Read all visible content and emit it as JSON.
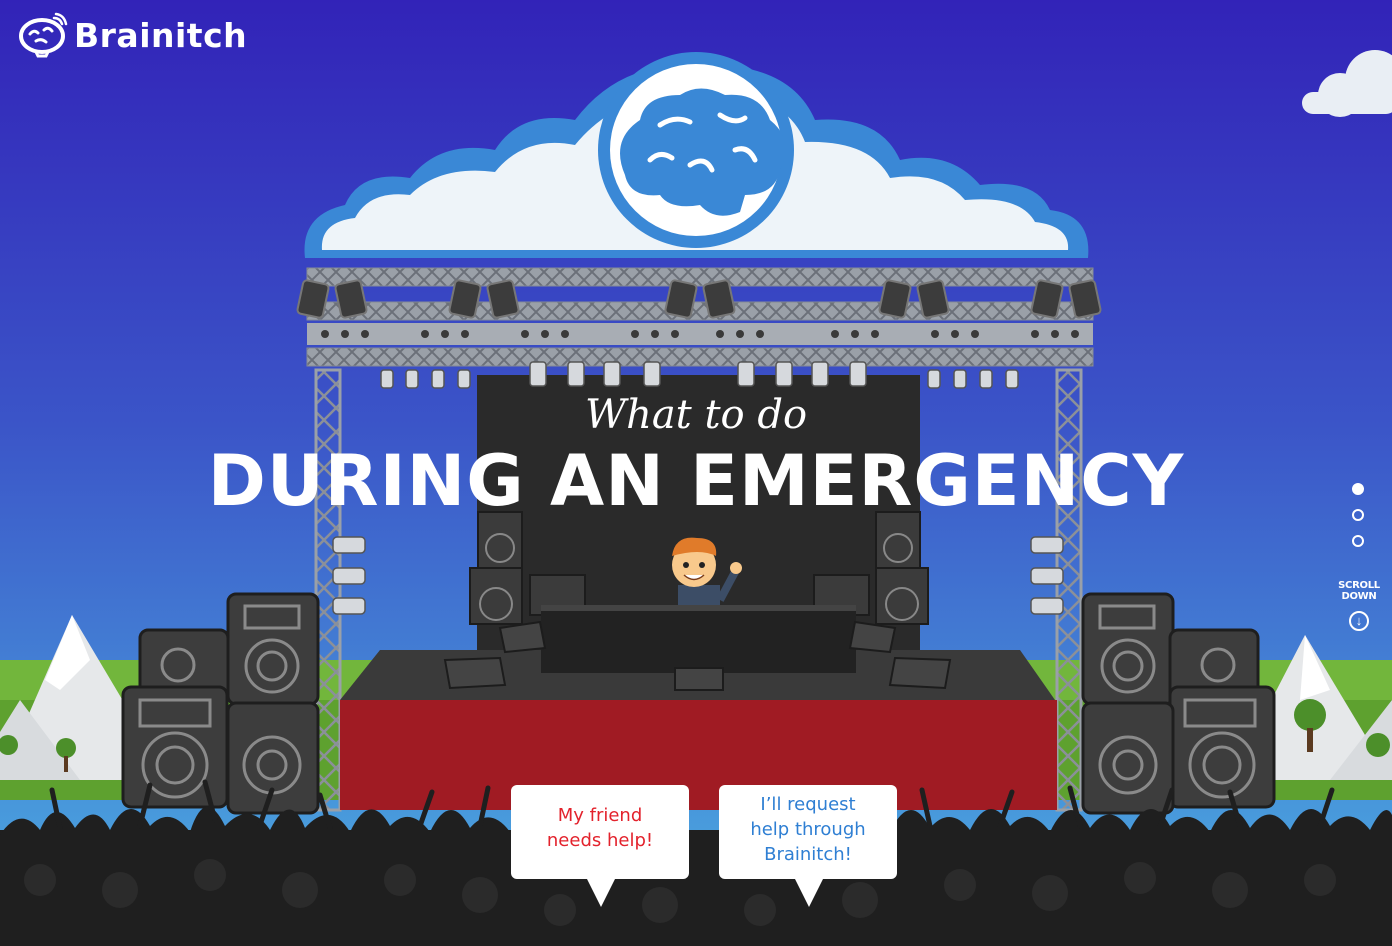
{
  "brand": {
    "name": "Brainitch"
  },
  "hero": {
    "subtitle": "What to do",
    "title": "DURING AN EMERGENCY"
  },
  "pagination": {
    "count": 3,
    "active_index": 0
  },
  "scroll_down": {
    "line1": "SCROLL",
    "line2": "DOWN",
    "icon": "arrow-down-circle-icon"
  },
  "options": [
    {
      "label_lines": [
        "My friend",
        "needs help!"
      ],
      "color": "#e3222c"
    },
    {
      "label_lines": [
        "I’ll request",
        "help through",
        "Brainitch!"
      ],
      "color": "#2f7fd3"
    }
  ],
  "colors": {
    "sky_top": "#3324b8",
    "sky_bottom": "#4ca9e0",
    "grass": "#6fb33a",
    "stage_red": "#a51c24",
    "crowd": "#1e1e1e",
    "cloud_blue": "#3a88d6"
  }
}
